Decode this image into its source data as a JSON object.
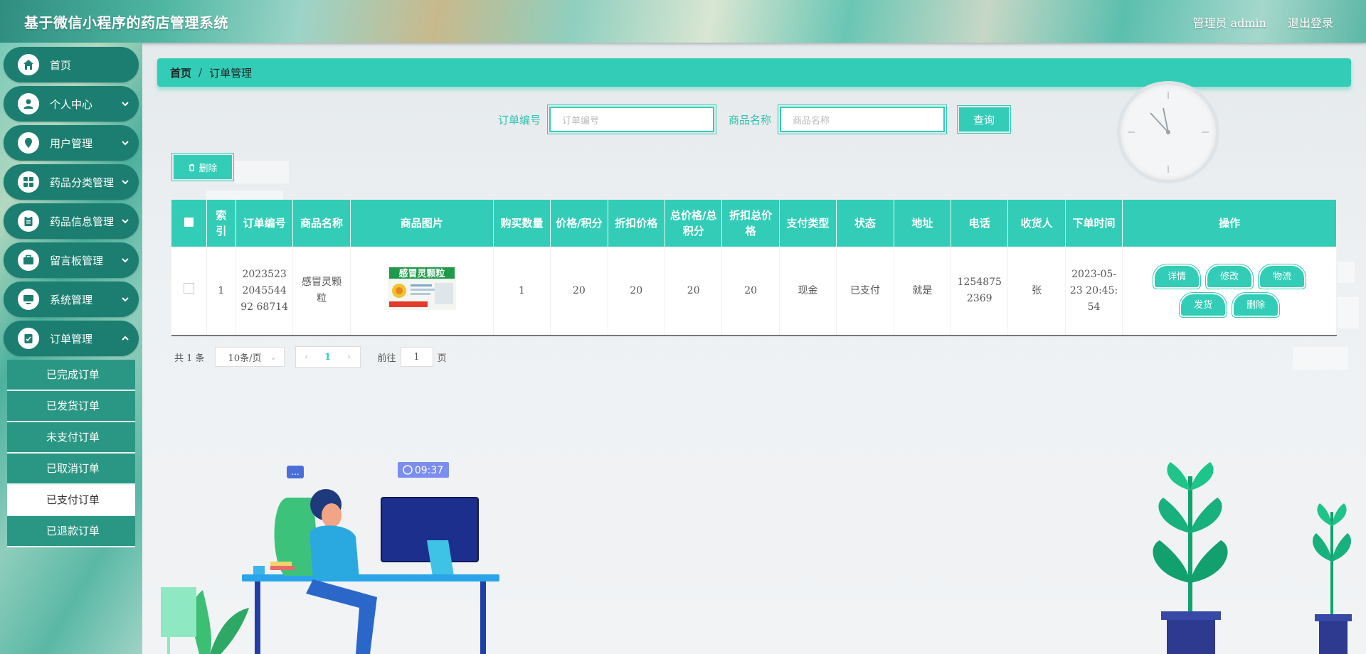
{
  "header": {
    "title": "基于微信小程序的药店管理系统",
    "user": "管理员 admin",
    "logout": "退出登录"
  },
  "sidebar": {
    "items": [
      {
        "label": "首页",
        "icon": "home-icon"
      },
      {
        "label": "个人中心",
        "icon": "user-icon"
      },
      {
        "label": "用户管理",
        "icon": "location-icon"
      },
      {
        "label": "药品分类管理",
        "icon": "grid-icon"
      },
      {
        "label": "药品信息管理",
        "icon": "clipboard-icon"
      },
      {
        "label": "留言板管理",
        "icon": "briefcase-icon"
      },
      {
        "label": "系统管理",
        "icon": "monitor-icon"
      },
      {
        "label": "订单管理",
        "icon": "order-icon"
      }
    ],
    "sub_items": [
      "已完成订单",
      "已发货订单",
      "未支付订单",
      "已取消订单",
      "已支付订单",
      "已退款订单"
    ],
    "active_sub": "已支付订单"
  },
  "breadcrumb": {
    "home": "首页",
    "separator": "/",
    "current": "订单管理"
  },
  "search": {
    "order_label": "订单编号",
    "order_placeholder": "订单编号",
    "product_label": "商品名称",
    "product_placeholder": "商品名称",
    "query_button": "查询"
  },
  "toolbar": {
    "delete_button": "删除"
  },
  "table": {
    "headers": [
      "索引",
      "订单编号",
      "商品名称",
      "商品图片",
      "购买数量",
      "价格/积分",
      "折扣价格",
      "总价格/总积分",
      "折扣总价格",
      "支付类型",
      "状态",
      "地址",
      "电话",
      "收货人",
      "下单时间",
      "操作"
    ],
    "rows": [
      {
        "index": "1",
        "order_no": "2023523204554492 68714",
        "product_name": "感冒灵颗粒",
        "product_image_label": "感冒灵颗粒",
        "quantity": "1",
        "price": "20",
        "discount_price": "20",
        "total_price": "20",
        "discount_total": "20",
        "pay_type": "现金",
        "status": "已支付",
        "address": "就是",
        "phone": "12548752369",
        "receiver": "张",
        "order_time": "2023-05-23 20:45:54",
        "actions": [
          "详情",
          "修改",
          "物流",
          "发货",
          "删除"
        ]
      }
    ]
  },
  "pagination": {
    "total": "共 1 条",
    "page_size": "10条/页",
    "current_page": "1",
    "goto_prefix": "前往",
    "goto_value": "1",
    "goto_suffix": "页"
  },
  "illustration": {
    "clock_time": "09:37",
    "chat_bubble": "..."
  },
  "colors": {
    "accent": "#33cdb7",
    "sidebar_item": "#1b7e70",
    "submenu": "#2a9784"
  }
}
